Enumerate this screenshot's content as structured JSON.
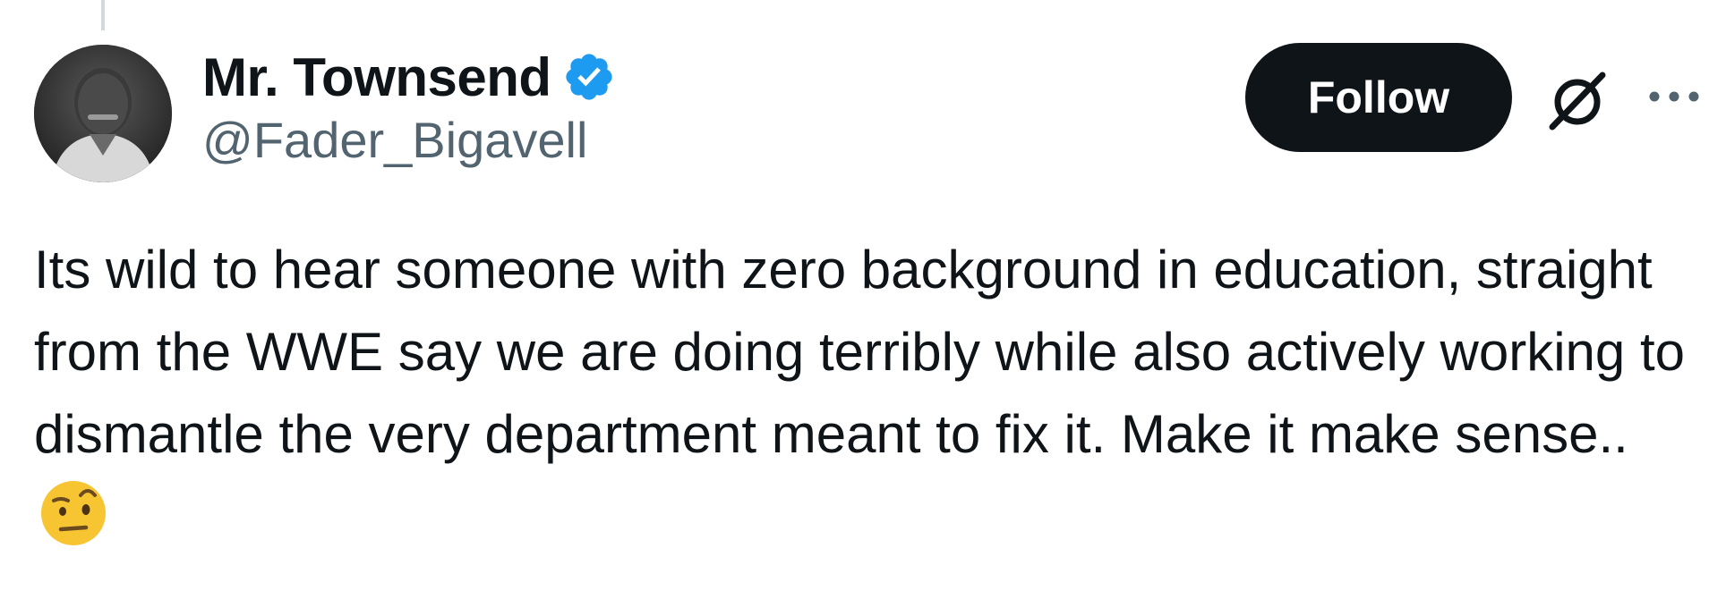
{
  "tweet": {
    "author": {
      "display_name": "Mr. Townsend",
      "handle": "@Fader_Bigavell",
      "verified": true,
      "verified_color": "#1d9bf0"
    },
    "follow_label": "Follow",
    "text": "Its wild to hear someone with zero background in education, straight from the WWE say we are doing terribly while also actively working to dismantle the very department meant to fix it. Make it make sense..",
    "emoji": "face-with-raised-eyebrow",
    "icons": {
      "grok": "grok-icon",
      "more": "more-icon"
    }
  }
}
